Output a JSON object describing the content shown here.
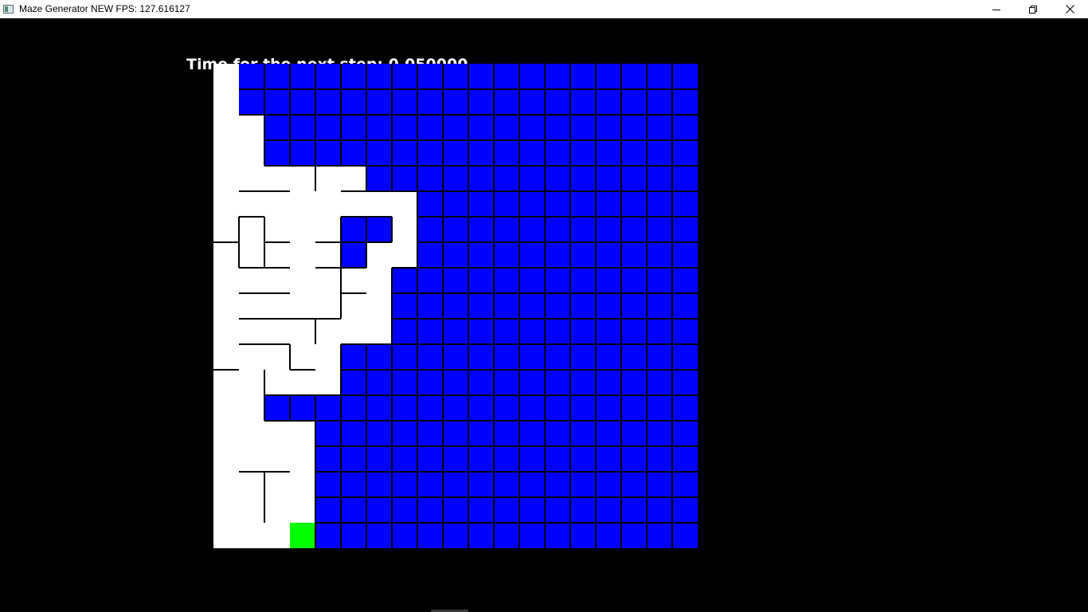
{
  "window": {
    "title": "Maze Generator NEW FPS: 127.616127",
    "icon": "app-window-icon",
    "controls": [
      "minimize-icon",
      "restore-icon",
      "close-icon"
    ]
  },
  "hud": {
    "step_label": "Time for the next step:",
    "step_value": "0.050000"
  },
  "maze": {
    "columns": 19,
    "rows": 19,
    "colors": {
      "visited": "#ffffff",
      "unvisited": "#0000ff",
      "current": "#00ff00",
      "wall": "#000000"
    },
    "current_cell": {
      "row": 18,
      "col": 3
    },
    "visited_cells": [
      [
        0
      ],
      [
        0
      ],
      [
        0,
        1
      ],
      [
        0,
        1
      ],
      [
        0,
        1,
        2,
        3,
        4,
        5
      ],
      [
        0,
        1,
        2,
        3,
        4,
        5,
        6,
        7
      ],
      [
        0,
        1,
        2,
        3,
        4,
        7
      ],
      [
        0,
        1,
        2,
        3,
        4,
        6,
        7
      ],
      [
        0,
        1,
        2,
        3,
        4,
        5,
        6
      ],
      [
        0,
        1,
        2,
        3,
        4,
        5,
        6
      ],
      [
        0,
        1,
        2,
        3,
        4,
        5,
        6
      ],
      [
        0,
        1,
        2,
        3,
        4
      ],
      [
        0,
        1,
        2,
        3,
        4
      ],
      [
        0,
        1
      ],
      [
        0,
        1,
        2,
        3
      ],
      [
        0,
        1,
        2,
        3
      ],
      [
        0,
        1,
        2,
        3
      ],
      [
        0,
        1,
        2,
        3
      ],
      [
        0,
        1,
        2
      ]
    ],
    "open_walls": {
      "right": [
        [
          0,
          0
        ],
        [
          1,
          0
        ],
        [
          2,
          0
        ],
        [
          3,
          0
        ],
        [
          4,
          0
        ],
        [
          4,
          1
        ],
        [
          4,
          2
        ],
        [
          4,
          4
        ],
        [
          5,
          0
        ],
        [
          5,
          1
        ],
        [
          5,
          2
        ],
        [
          5,
          3
        ],
        [
          5,
          4
        ],
        [
          5,
          5
        ],
        [
          5,
          6
        ],
        [
          6,
          2
        ],
        [
          6,
          3
        ],
        [
          7,
          2
        ],
        [
          7,
          3
        ],
        [
          7,
          6
        ],
        [
          8,
          0
        ],
        [
          8,
          1
        ],
        [
          8,
          2
        ],
        [
          8,
          3
        ],
        [
          8,
          5
        ],
        [
          9,
          0
        ],
        [
          9,
          1
        ],
        [
          9,
          2
        ],
        [
          9,
          3
        ],
        [
          9,
          5
        ],
        [
          10,
          0
        ],
        [
          10,
          1
        ],
        [
          10,
          2
        ],
        [
          10,
          4
        ],
        [
          10,
          5
        ],
        [
          11,
          0
        ],
        [
          11,
          1
        ],
        [
          11,
          3
        ],
        [
          12,
          0
        ],
        [
          12,
          2
        ],
        [
          12,
          3
        ],
        [
          13,
          0
        ],
        [
          14,
          0
        ],
        [
          14,
          1
        ],
        [
          14,
          2
        ],
        [
          15,
          0
        ],
        [
          15,
          1
        ],
        [
          15,
          2
        ],
        [
          16,
          0
        ],
        [
          16,
          2
        ],
        [
          17,
          0
        ],
        [
          17,
          2
        ],
        [
          18,
          0
        ],
        [
          18,
          1
        ],
        [
          18,
          2
        ]
      ],
      "bottom": [
        [
          0,
          0
        ],
        [
          1,
          0
        ],
        [
          2,
          0
        ],
        [
          2,
          1
        ],
        [
          3,
          0
        ],
        [
          3,
          1
        ],
        [
          4,
          0
        ],
        [
          4,
          3
        ],
        [
          4,
          4
        ],
        [
          5,
          0
        ],
        [
          5,
          2
        ],
        [
          5,
          3
        ],
        [
          5,
          4
        ],
        [
          5,
          7
        ],
        [
          6,
          1
        ],
        [
          6,
          3
        ],
        [
          6,
          7
        ],
        [
          7,
          0
        ],
        [
          7,
          3
        ],
        [
          7,
          6
        ],
        [
          8,
          0
        ],
        [
          8,
          3
        ],
        [
          8,
          4
        ],
        [
          8,
          6
        ],
        [
          9,
          0
        ],
        [
          9,
          5
        ],
        [
          9,
          6
        ],
        [
          10,
          0
        ],
        [
          10,
          3
        ],
        [
          10,
          4
        ],
        [
          11,
          1
        ],
        [
          11,
          2
        ],
        [
          11,
          4
        ],
        [
          12,
          0
        ],
        [
          12,
          1
        ],
        [
          13,
          0
        ],
        [
          13,
          1
        ],
        [
          14,
          0
        ],
        [
          14,
          1
        ],
        [
          14,
          2
        ],
        [
          14,
          3
        ],
        [
          15,
          0
        ],
        [
          15,
          3
        ],
        [
          16,
          0
        ],
        [
          16,
          1
        ],
        [
          16,
          2
        ],
        [
          16,
          3
        ],
        [
          17,
          0
        ],
        [
          17,
          1
        ],
        [
          17,
          2
        ],
        [
          17,
          3
        ]
      ]
    }
  }
}
